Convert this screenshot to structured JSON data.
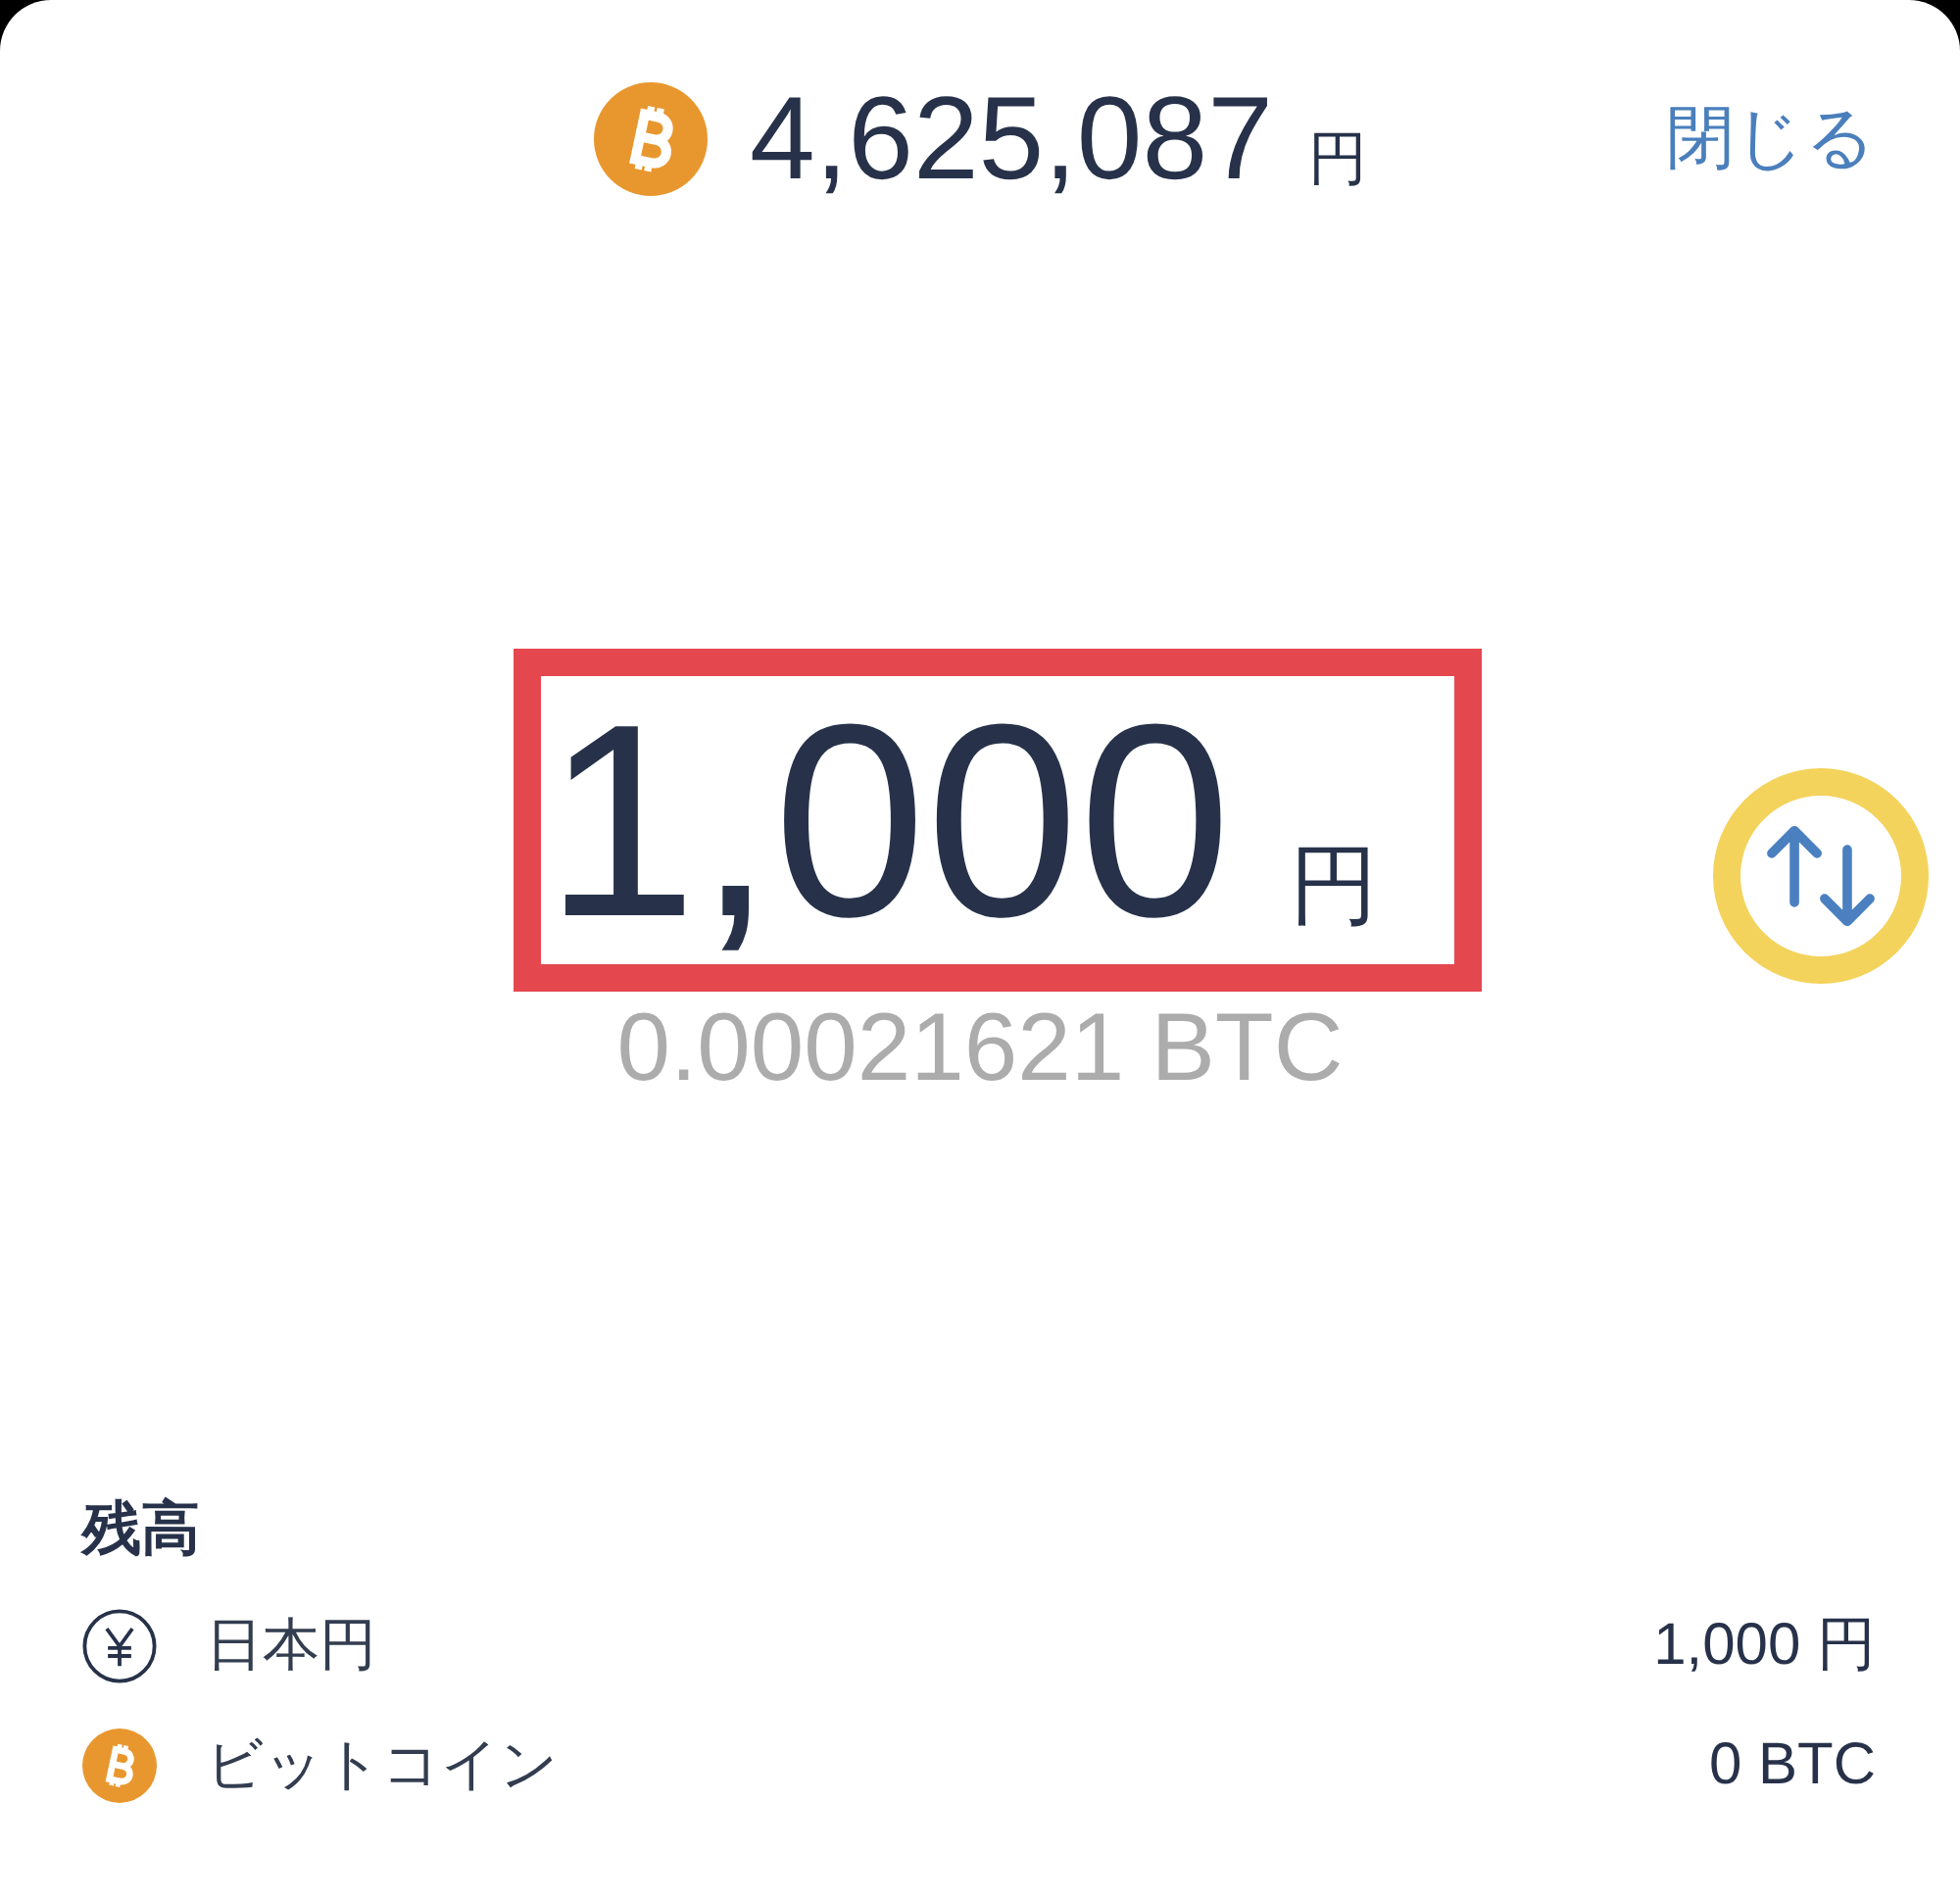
{
  "header": {
    "rate": "4,625,087",
    "rate_unit": "円",
    "close_button": "閉じる"
  },
  "amount": {
    "value": "1,000",
    "unit": "円",
    "highlighted": true,
    "converted": "0.00021621 BTC"
  },
  "swap_button": {
    "highlighted": true
  },
  "balance": {
    "title": "残高",
    "rows": [
      {
        "kind": "yen",
        "name": "日本円",
        "amount": "1,000 円"
      },
      {
        "kind": "bitcoin",
        "name": "ビットコイン",
        "amount": "0 BTC"
      }
    ]
  }
}
